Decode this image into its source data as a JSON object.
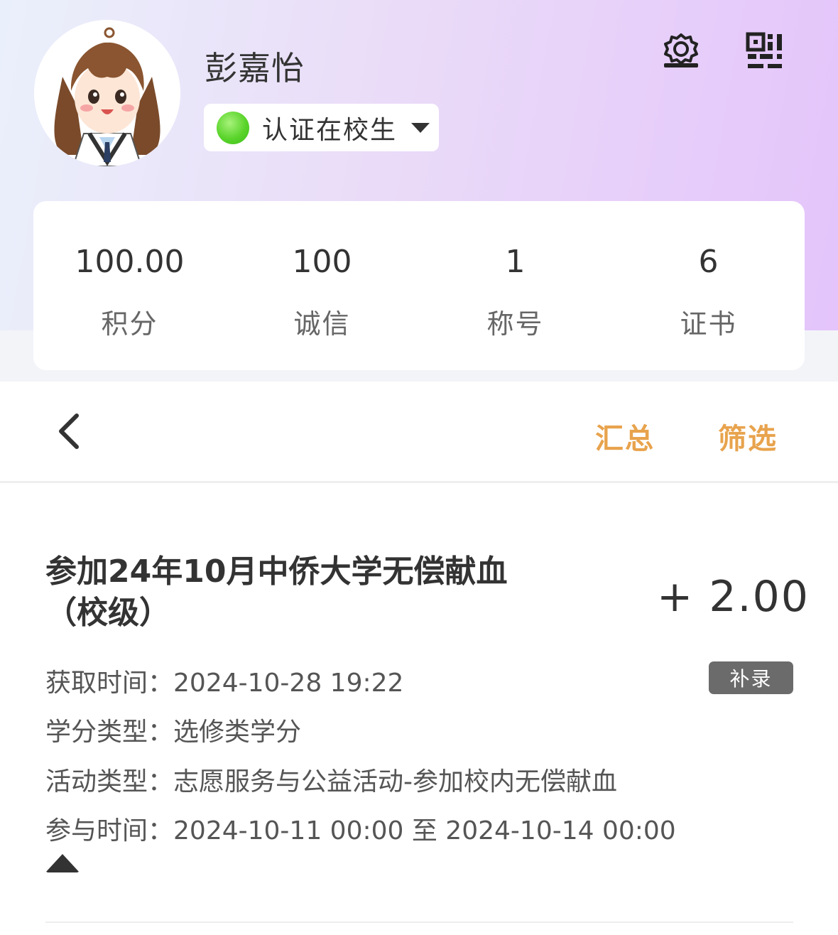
{
  "profile": {
    "name": "彭嘉怡",
    "status_label": "认证在校生",
    "status_color": "#52cc24"
  },
  "header_icons": [
    "award-icon",
    "qr-code-icon"
  ],
  "stats": [
    {
      "value": "100.00",
      "label": "积分"
    },
    {
      "value": "100",
      "label": "诚信"
    },
    {
      "value": "1",
      "label": "称号"
    },
    {
      "value": "6",
      "label": "证书"
    }
  ],
  "toolbar": {
    "summary_label": "汇总",
    "filter_label": "筛选",
    "accent": "#e8a34d"
  },
  "record": {
    "title_line1": "参加24年10月中侨大学无偿献血",
    "title_line2": "（校级）",
    "points": "+ 2.00",
    "badge": "补录",
    "fields": [
      {
        "label": "获取时间：",
        "value": "2024-10-28 19:22"
      },
      {
        "label": "学分类型：",
        "value": "选修类学分"
      },
      {
        "label": "活动类型：",
        "value": "志愿服务与公益活动-参加校内无偿献血"
      },
      {
        "label": "参与时间：",
        "value": "2024-10-11 00:00 至 2024-10-14 00:00"
      }
    ]
  },
  "colors": {
    "hero_start": "#eaf0fb",
    "hero_end": "#e4c4fb",
    "badge_bg": "#6b6b6b"
  }
}
